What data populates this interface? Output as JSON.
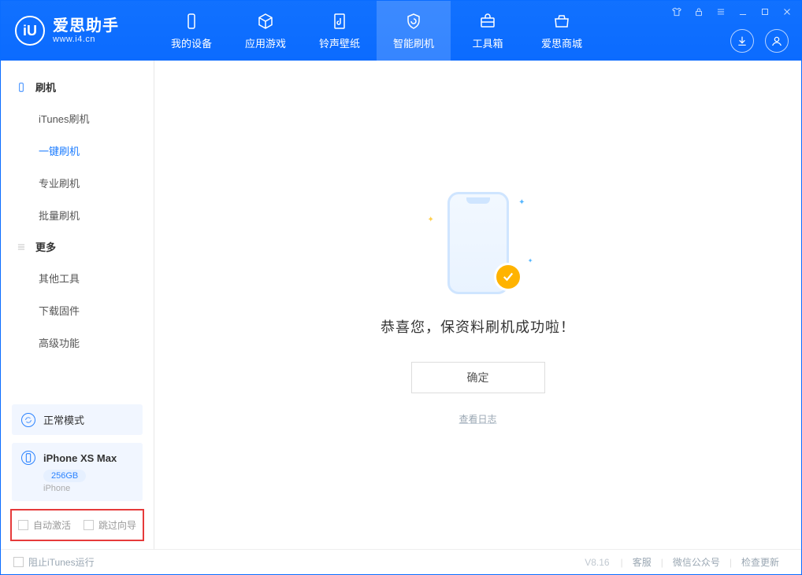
{
  "brand": {
    "name_cn": "爱思助手",
    "name_en": "www.i4.cn",
    "logo_letter": "iU"
  },
  "nav": {
    "tabs": [
      {
        "label": "我的设备"
      },
      {
        "label": "应用游戏"
      },
      {
        "label": "铃声壁纸"
      },
      {
        "label": "智能刷机"
      },
      {
        "label": "工具箱"
      },
      {
        "label": "爱思商城"
      }
    ]
  },
  "sidebar": {
    "group_flash": "刷机",
    "group_more": "更多",
    "flash_items": [
      {
        "label": "iTunes刷机"
      },
      {
        "label": "一键刷机"
      },
      {
        "label": "专业刷机"
      },
      {
        "label": "批量刷机"
      }
    ],
    "more_items": [
      {
        "label": "其他工具"
      },
      {
        "label": "下载固件"
      },
      {
        "label": "高级功能"
      }
    ],
    "mode_label": "正常模式",
    "device": {
      "name": "iPhone XS Max",
      "storage": "256GB",
      "type": "iPhone"
    },
    "checkbox_auto_activate": "自动激活",
    "checkbox_skip_guide": "跳过向导"
  },
  "main": {
    "success_text": "恭喜您，保资料刷机成功啦！",
    "confirm_label": "确定",
    "view_log_label": "查看日志"
  },
  "footer": {
    "block_itunes": "阻止iTunes运行",
    "version": "V8.16",
    "links": [
      "客服",
      "微信公众号",
      "检查更新"
    ]
  }
}
